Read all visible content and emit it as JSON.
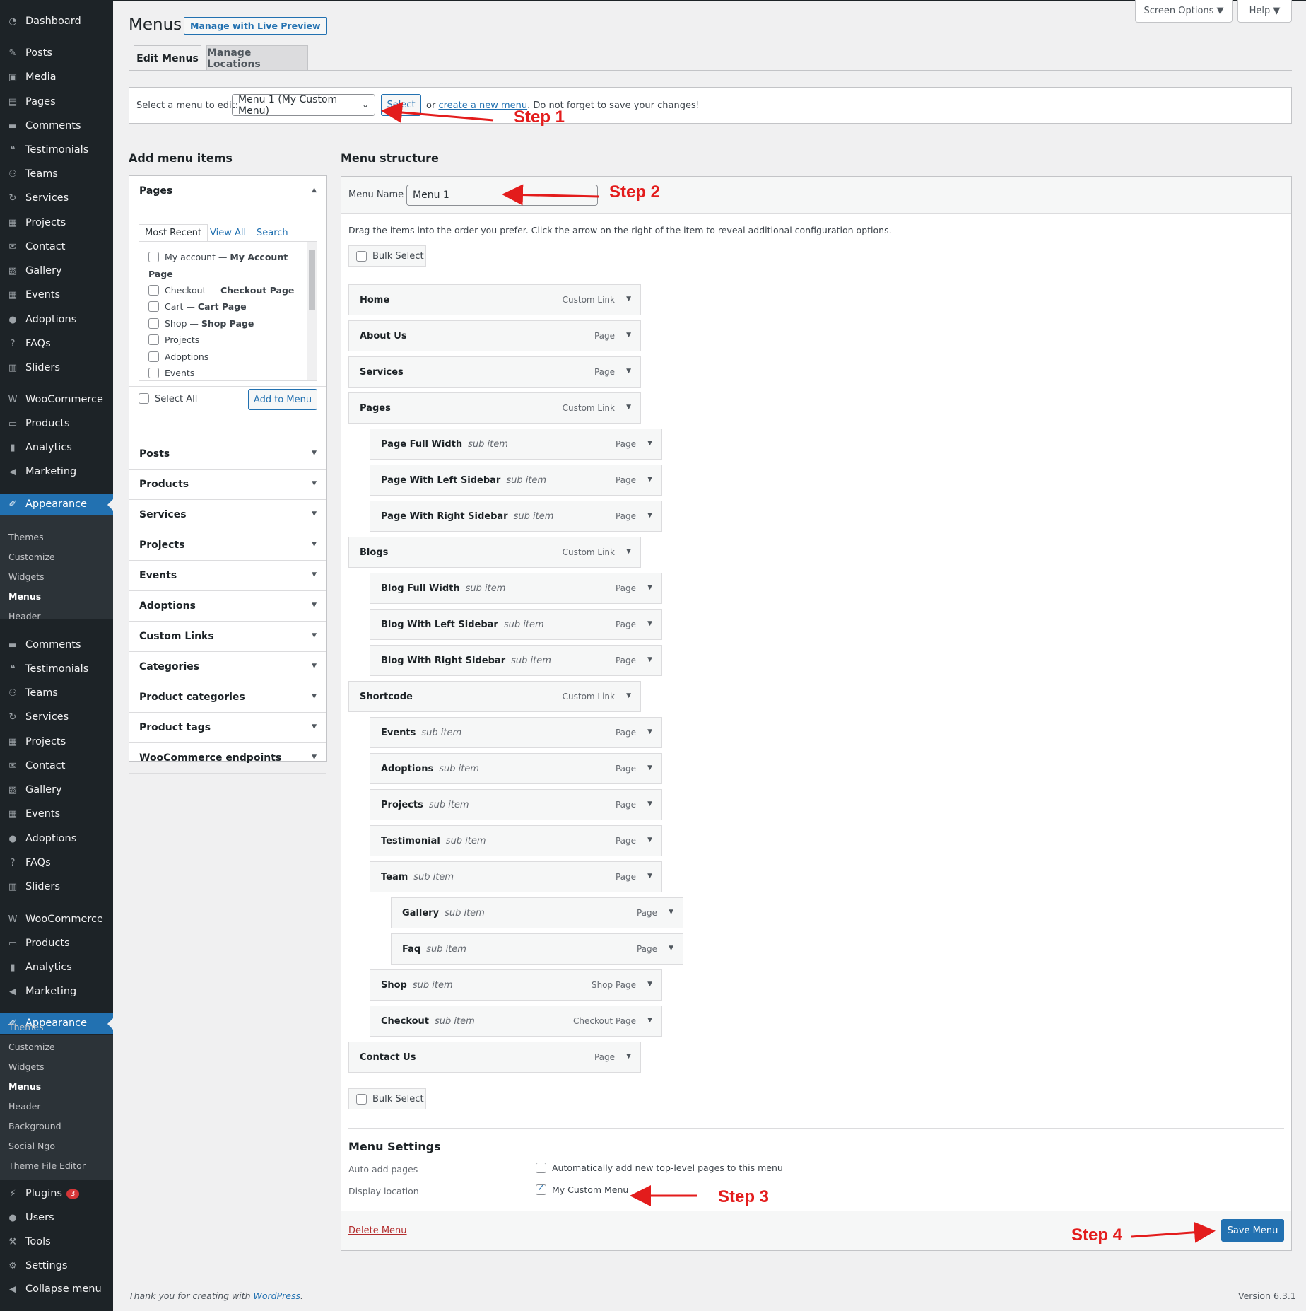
{
  "sidebar": {
    "top_items": [
      {
        "label": "Dashboard",
        "icon": "dashboard-icon"
      },
      {
        "label": "Posts",
        "icon": "pin-icon"
      },
      {
        "label": "Media",
        "icon": "media-icon"
      },
      {
        "label": "Pages",
        "icon": "page-icon"
      },
      {
        "label": "Comments",
        "icon": "comment-icon"
      },
      {
        "label": "Testimonials",
        "icon": "testimonial-icon"
      },
      {
        "label": "Teams",
        "icon": "groups-icon"
      },
      {
        "label": "Services",
        "icon": "update-icon"
      },
      {
        "label": "Projects",
        "icon": "grid-icon"
      },
      {
        "label": "Contact",
        "icon": "email-icon"
      },
      {
        "label": "Gallery",
        "icon": "gallery-icon"
      },
      {
        "label": "Events",
        "icon": "grid-icon"
      },
      {
        "label": "Adoptions",
        "icon": "user-icon"
      },
      {
        "label": "FAQs",
        "icon": "faq-icon"
      },
      {
        "label": "Sliders",
        "icon": "slider-icon"
      },
      {
        "label": "WooCommerce",
        "icon": "woo-icon"
      },
      {
        "label": "Products",
        "icon": "archive-icon"
      },
      {
        "label": "Analytics",
        "icon": "chart-bar-icon"
      },
      {
        "label": "Marketing",
        "icon": "megaphone-icon"
      },
      {
        "label": "Appearance",
        "icon": "brush-icon"
      }
    ],
    "appearance_sub_1": [
      "Themes",
      "Customize",
      "Widgets",
      "Menus",
      "Header"
    ],
    "second_items": [
      {
        "label": "Comments",
        "icon": "comment-icon"
      },
      {
        "label": "Testimonials",
        "icon": "testimonial-icon"
      },
      {
        "label": "Teams",
        "icon": "groups-icon"
      },
      {
        "label": "Services",
        "icon": "update-icon"
      },
      {
        "label": "Projects",
        "icon": "grid-icon"
      },
      {
        "label": "Contact",
        "icon": "email-icon"
      },
      {
        "label": "Gallery",
        "icon": "gallery-icon"
      },
      {
        "label": "Events",
        "icon": "grid-icon"
      },
      {
        "label": "Adoptions",
        "icon": "user-icon"
      },
      {
        "label": "FAQs",
        "icon": "faq-icon"
      },
      {
        "label": "Sliders",
        "icon": "slider-icon"
      },
      {
        "label": "WooCommerce",
        "icon": "woo-icon"
      },
      {
        "label": "Products",
        "icon": "archive-icon"
      },
      {
        "label": "Analytics",
        "icon": "chart-bar-icon"
      },
      {
        "label": "Marketing",
        "icon": "megaphone-icon"
      },
      {
        "label": "Appearance",
        "icon": "brush-icon"
      }
    ],
    "appearance_sub_2": [
      "Themes",
      "Customize",
      "Widgets",
      "Menus",
      "Header",
      "Background",
      "Social Ngo",
      "Theme File Editor"
    ],
    "bottom_items": [
      {
        "label": "Plugins",
        "icon": "plugin-icon",
        "badge": "3"
      },
      {
        "label": "Users",
        "icon": "user-icon"
      },
      {
        "label": "Tools",
        "icon": "wrench-icon"
      },
      {
        "label": "Settings",
        "icon": "settings-icon"
      },
      {
        "label": "Collapse menu",
        "icon": "collapse-icon"
      }
    ]
  },
  "header": {
    "title": "Menus",
    "live_preview": "Manage with Live Preview",
    "screen_options": "Screen Options ▼",
    "help": "Help ▼"
  },
  "tabs": {
    "edit": "Edit Menus",
    "locations": "Manage Locations"
  },
  "select_bar": {
    "label": "Select a menu to edit:",
    "selected_menu": "Menu 1 (My Custom Menu)",
    "select_button": "Select",
    "or": "or",
    "create_link": "create a new menu",
    "reminder": ". Do not forget to save your changes!"
  },
  "add_items": {
    "title": "Add menu items",
    "pages_panel": {
      "title": "Pages",
      "tabs": [
        "Most Recent",
        "View All",
        "Search"
      ],
      "items": [
        {
          "pre": "My account — ",
          "bold": "My Account",
          "cont": "Page"
        },
        {
          "pre": "Checkout — ",
          "bold": "Checkout Page"
        },
        {
          "pre": "Cart — ",
          "bold": "Cart Page"
        },
        {
          "pre": "Shop — ",
          "bold": "Shop Page"
        },
        {
          "pre": "Projects",
          "bold": ""
        },
        {
          "pre": "Adoptions",
          "bold": ""
        },
        {
          "pre": "Events",
          "bold": ""
        }
      ],
      "select_all": "Select All",
      "add_button": "Add to Menu"
    },
    "sections": [
      "Posts",
      "Products",
      "Services",
      "Projects",
      "Events",
      "Adoptions",
      "Custom Links",
      "Categories",
      "Product categories",
      "Product tags",
      "WooCommerce endpoints"
    ]
  },
  "structure": {
    "title": "Menu structure",
    "menu_name_label": "Menu Name",
    "menu_name_value": "Menu 1",
    "instructions": "Drag the items into the order you prefer. Click the arrow on the right of the item to reveal additional configuration options.",
    "bulk_select": "Bulk Select",
    "items": [
      {
        "title": "Home",
        "sub": "",
        "kind": "Custom Link",
        "depth": 0
      },
      {
        "title": "About Us",
        "sub": "",
        "kind": "Page",
        "depth": 0
      },
      {
        "title": "Services",
        "sub": "",
        "kind": "Page",
        "depth": 0
      },
      {
        "title": "Pages",
        "sub": "",
        "kind": "Custom Link",
        "depth": 0
      },
      {
        "title": "Page Full Width",
        "sub": "sub item",
        "kind": "Page",
        "depth": 1
      },
      {
        "title": "Page With Left Sidebar",
        "sub": "sub item",
        "kind": "Page",
        "depth": 1
      },
      {
        "title": "Page With Right Sidebar",
        "sub": "sub item",
        "kind": "Page",
        "depth": 1
      },
      {
        "title": "Blogs",
        "sub": "",
        "kind": "Custom Link",
        "depth": 0
      },
      {
        "title": "Blog Full Width",
        "sub": "sub item",
        "kind": "Page",
        "depth": 1
      },
      {
        "title": "Blog With Left Sidebar",
        "sub": "sub item",
        "kind": "Page",
        "depth": 1
      },
      {
        "title": "Blog With Right Sidebar",
        "sub": "sub item",
        "kind": "Page",
        "depth": 1
      },
      {
        "title": "Shortcode",
        "sub": "",
        "kind": "Custom Link",
        "depth": 0
      },
      {
        "title": "Events",
        "sub": "sub item",
        "kind": "Page",
        "depth": 1
      },
      {
        "title": "Adoptions",
        "sub": "sub item",
        "kind": "Page",
        "depth": 1
      },
      {
        "title": "Projects",
        "sub": "sub item",
        "kind": "Page",
        "depth": 1
      },
      {
        "title": "Testimonial",
        "sub": "sub item",
        "kind": "Page",
        "depth": 1
      },
      {
        "title": "Team",
        "sub": "sub item",
        "kind": "Page",
        "depth": 1
      },
      {
        "title": "Gallery",
        "sub": "sub item",
        "kind": "Page",
        "depth": 2
      },
      {
        "title": "Faq",
        "sub": "sub item",
        "kind": "Page",
        "depth": 2
      },
      {
        "title": "Shop",
        "sub": "sub item",
        "kind": "Shop Page",
        "depth": 1
      },
      {
        "title": "Checkout",
        "sub": "sub item",
        "kind": "Checkout Page",
        "depth": 1
      },
      {
        "title": "Contact Us",
        "sub": "",
        "kind": "Page",
        "depth": 0
      }
    ],
    "settings": {
      "title": "Menu Settings",
      "auto_add_label": "Auto add pages",
      "auto_add_option": "Automatically add new top-level pages to this menu",
      "auto_add_checked": false,
      "location_label": "Display location",
      "location_option": "My Custom Menu",
      "location_checked": true
    },
    "delete_menu": "Delete Menu",
    "save_menu": "Save Menu"
  },
  "annotations": {
    "step1": "Step 1",
    "step2": "Step 2",
    "step3": "Step 3",
    "step4": "Step 4"
  },
  "footer": {
    "thanks": "Thank you for creating with ",
    "wp_link": "WordPress",
    "period": ".",
    "version": "Version 6.3.1"
  },
  "colors": {
    "sidebar_bg": "#1d2327",
    "accent": "#2271b1",
    "annotation_red": "#e31c1c",
    "delete_red": "#b32d2e"
  }
}
